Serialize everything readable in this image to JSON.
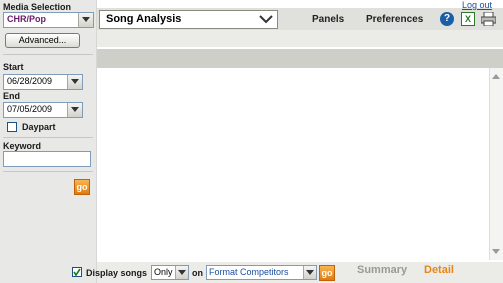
{
  "header": {
    "logout_label": "Log out",
    "report_selected": "Song Analysis",
    "tabs": [
      "Panels",
      "Preferences"
    ]
  },
  "sidebar": {
    "media_selection_label": "Media Selection",
    "media_value": "CHR/Pop",
    "advanced_label": "Advanced...",
    "start_label": "Start",
    "start_date": "06/28/2009",
    "end_label": "End",
    "end_date": "07/05/2009",
    "daypart_label": "Daypart",
    "daypart_checked": false,
    "keyword_label": "Keyword",
    "keyword_value": "",
    "go_label": "go"
  },
  "footer": {
    "display_songs_checked": true,
    "display_songs_label": "Display songs",
    "only_value": "Only",
    "on_label": "on",
    "format_value": "Format Competitors",
    "go_label": "go",
    "summary_label": "Summary",
    "detail_label": "Detail"
  },
  "icons": [
    "help-icon",
    "excel-icon",
    "print-icon"
  ],
  "colors": {
    "link": "#1a4fa0",
    "media_value": "#6a1a6a",
    "format_value": "#1a4fa0",
    "detail_active": "#e8861a",
    "summary_inactive": "#9a9a94"
  }
}
